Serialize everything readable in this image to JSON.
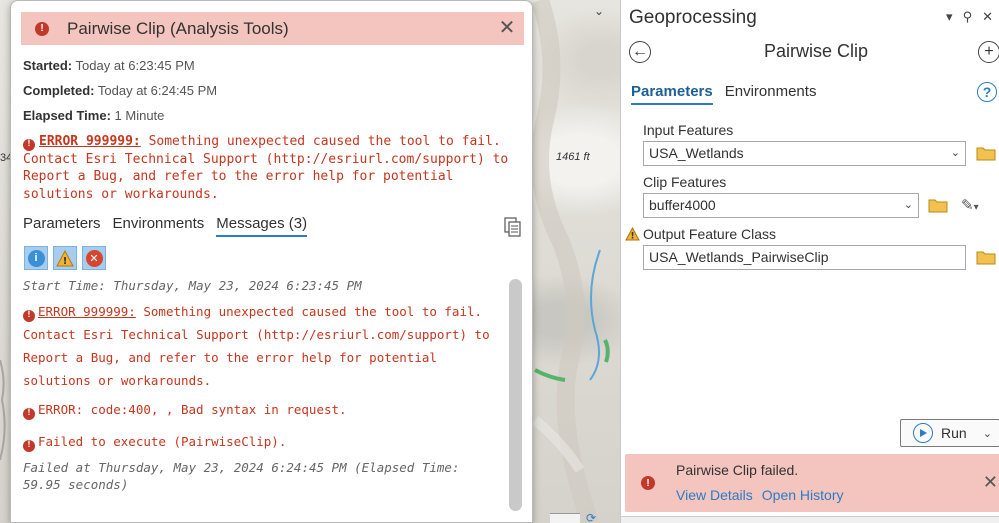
{
  "map": {
    "elevation_label": "1461 ft",
    "left_label": "34"
  },
  "details": {
    "title": "Pairwise Clip (Analysis Tools)",
    "started_label": "Started:",
    "started_value": "Today at 6:23:45 PM",
    "completed_label": "Completed:",
    "completed_value": "Today at 6:24:45 PM",
    "elapsed_label": "Elapsed Time:",
    "elapsed_value": "1 Minute",
    "summary_error_code": "ERROR 999999:",
    "summary_error_text": " Something unexpected caused the tool to fail. Contact Esri Technical Support (http://esriurl.com/support) to Report a Bug, and refer to the error help for potential solutions or workarounds.",
    "tabs": [
      {
        "label": "Parameters"
      },
      {
        "label": "Environments"
      },
      {
        "label": "Messages (3)"
      }
    ],
    "messages": {
      "start_time": "Start Time: Thursday, May 23, 2024 6:23:45 PM",
      "error1_code": "ERROR 999999:",
      "error1_text": " Something unexpected caused the tool to fail. Contact Esri Technical Support (http://esriurl.com/support) to Report a Bug, and refer to the error help for potential solutions or workarounds.",
      "error2": "ERROR: code:400, , Bad syntax in request.",
      "error3": "Failed to execute (PairwiseClip).",
      "failed_at": "Failed at Thursday, May 23, 2024 6:24:45 PM (Elapsed Time: 59.95 seconds)"
    }
  },
  "geoprocessing": {
    "pane_title": "Geoprocessing",
    "tool_title": "Pairwise Clip",
    "tabs": [
      {
        "label": "Parameters"
      },
      {
        "label": "Environments"
      }
    ],
    "help": "?",
    "input_features_label": "Input Features",
    "input_features_value": "USA_Wetlands",
    "clip_features_label": "Clip Features",
    "clip_features_value": "buffer4000",
    "output_label": "Output Feature Class",
    "output_value": "USA_Wetlands_PairwiseClip",
    "run_label": "Run",
    "fail_message": "Pairwise Clip failed.",
    "view_details": "View Details",
    "open_history": "Open History"
  },
  "colors": {
    "error_red": "#c6361f",
    "error_banner": "#f4c4be",
    "accent_blue": "#2a7cc7"
  }
}
